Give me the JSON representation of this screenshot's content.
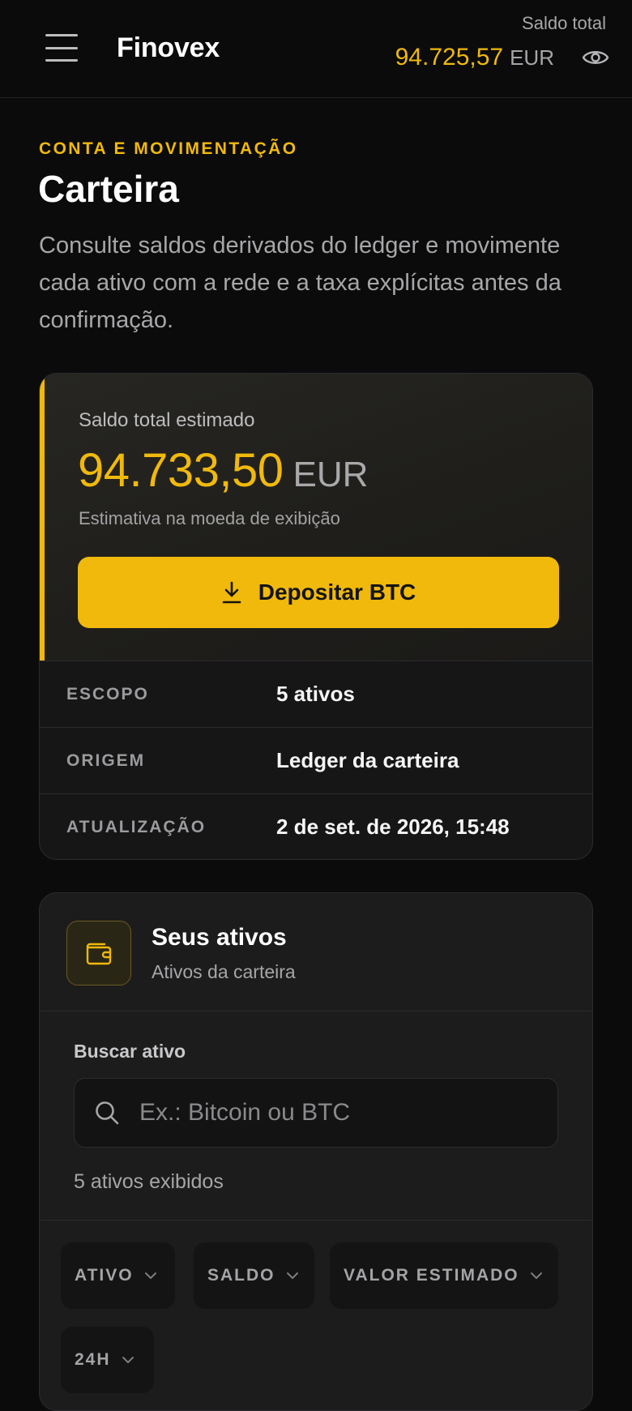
{
  "header": {
    "brand": "Finovex",
    "balance_label": "Saldo total",
    "balance_value": "94.725,57",
    "balance_currency": "EUR"
  },
  "intro": {
    "eyebrow": "CONTA E MOVIMENTAÇÃO",
    "title": "Carteira",
    "description": "Consulte saldos derivados do ledger e movimente cada ativo com a rede e a taxa explícitas antes da confirmação."
  },
  "summary": {
    "label": "Saldo total estimado",
    "value": "94.733,50",
    "currency": "EUR",
    "note": "Estimativa na moeda de exibição",
    "deposit_label": "Depositar BTC",
    "meta": [
      {
        "key": "ESCOPO",
        "value": "5 ativos"
      },
      {
        "key": "ORIGEM",
        "value": "Ledger da carteira"
      },
      {
        "key": "ATUALIZAÇÃO",
        "value": "2 de set. de 2026, 15:48"
      }
    ]
  },
  "assets": {
    "title": "Seus ativos",
    "subtitle": "Ativos da carteira",
    "search_label": "Buscar ativo",
    "search_placeholder": "Ex.: Bitcoin ou BTC",
    "count_text": "5 ativos exibidos",
    "sort_columns": [
      "ATIVO",
      "SALDO",
      "VALOR ESTIMADO",
      "24H"
    ]
  },
  "colors": {
    "accent": "#f0b90b",
    "background": "#0b0b0c",
    "card": "#1c1c1d"
  },
  "icons": {
    "menu": "menu-icon",
    "eye": "eye-icon",
    "download": "download-icon",
    "wallet": "wallet-icon",
    "search": "search-icon",
    "chevron": "chevron-down-icon"
  }
}
